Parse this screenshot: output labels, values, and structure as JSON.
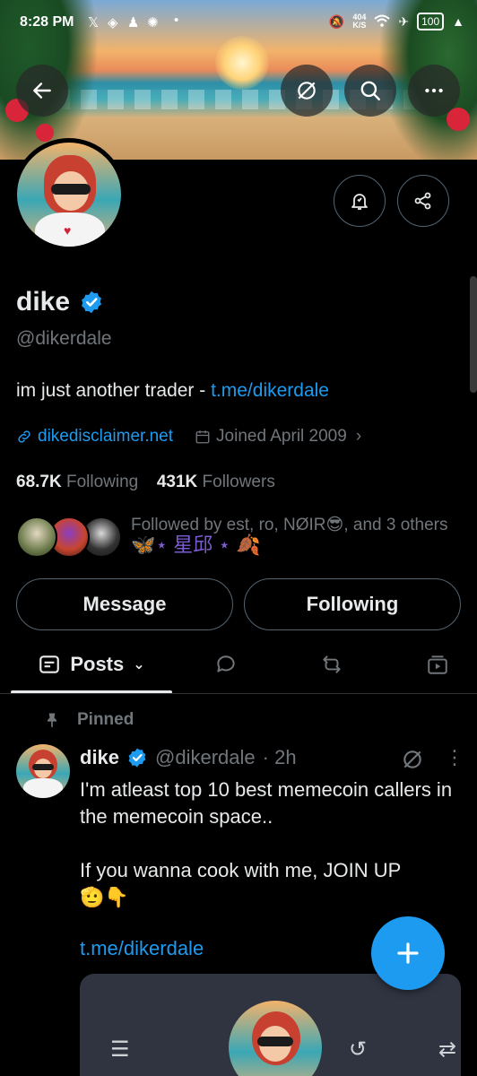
{
  "status_bar": {
    "time": "8:28 PM",
    "netspeed_value": "404",
    "netspeed_unit": "K/S",
    "battery": "100"
  },
  "profile": {
    "name": "dike",
    "handle": "@dikerdale",
    "bio_text": "im just another trader - ",
    "bio_link": "t.me/dikerdale",
    "website": "dikedisclaimer.net",
    "joined": "Joined April 2009",
    "following_count": "68.7K",
    "following_label": "Following",
    "followers_count": "431K",
    "followers_label": "Followers",
    "followed_by": "Followed by est, ro, NØIR😎, and 3 others",
    "followed_by_overlay": "🦋⋆ 星邱 ⋆ 🍂"
  },
  "actions": {
    "message": "Message",
    "following": "Following"
  },
  "tabs": {
    "posts": "Posts"
  },
  "post": {
    "pinned_label": "Pinned",
    "author": "dike",
    "handle": "@dikerdale",
    "time": "· 2h",
    "text_line1": "I'm atleast top 10 best memecoin callers in the memecoin space..",
    "text_line2": "If you wanna cook with me, JOIN UP",
    "emoji": "🫡👇",
    "link": "t.me/dikerdale"
  },
  "colors": {
    "accent": "#1d9bf0",
    "text": "#e7e9ea",
    "muted": "#71767b",
    "border": "#536471",
    "background": "#000000"
  }
}
